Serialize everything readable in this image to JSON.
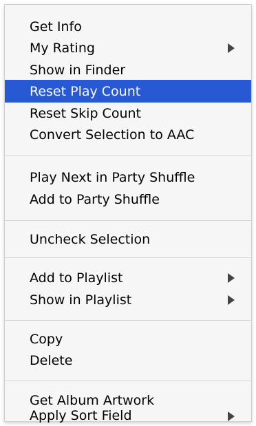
{
  "context_menu": {
    "items": [
      {
        "label": "Get Info"
      },
      {
        "label": "My Rating"
      },
      {
        "label": "Show in Finder"
      },
      {
        "label": "Reset Play Count",
        "highlighted": true
      },
      {
        "label": "Reset Skip Count"
      },
      {
        "label": "Convert Selection to AAC"
      },
      {
        "label": "Play Next in Party Shuffle"
      },
      {
        "label": "Add to Party Shuffle"
      },
      {
        "label": "Uncheck Selection"
      },
      {
        "label": "Add to Playlist"
      },
      {
        "label": "Show in Playlist"
      },
      {
        "label": "Copy"
      },
      {
        "label": "Delete"
      },
      {
        "label": "Get Album Artwork"
      },
      {
        "label": "Apply Sort Field"
      }
    ],
    "submenu_icon": "triangle-right-icon",
    "highlight_color": "#2659d3",
    "background_color": "#f6f6f6"
  }
}
